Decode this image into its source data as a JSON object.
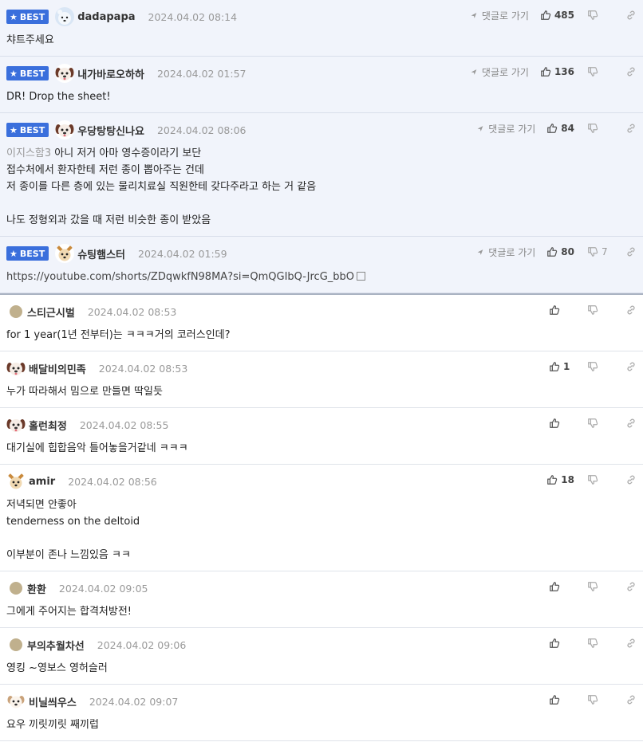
{
  "labels": {
    "best": "BEST",
    "reply": "댓글로 가기"
  },
  "colors": {
    "best_bg": "#f1f4fb",
    "badge": "#3a6fdc"
  },
  "comments": [
    {
      "best": true,
      "nick": "dadapapa",
      "date": "2024.04.02 08:14",
      "avatar": "bear-avatar",
      "up": "485",
      "down": "",
      "lines": [
        "챠트주세요"
      ]
    },
    {
      "best": true,
      "nick": "내가바로오하하",
      "date": "2024.04.02 01:57",
      "avatar": "dog-avatar",
      "up": "136",
      "down": "",
      "lines": [
        "DR! Drop the sheet!"
      ]
    },
    {
      "best": true,
      "nick": "우당탕탕신나요",
      "date": "2024.04.02 08:06",
      "avatar": "dog-avatar",
      "up": "84",
      "down": "",
      "mention": "이지스함3",
      "lines": [
        "아니 저거 아마 영수증이라기 보단",
        "접수처에서 환자한테 저런 종이 뽑아주는 건데",
        "저 종이를 다른 층에 있는 물리치료실 직원한테 갖다주라고 하는 거 같음",
        "",
        "나도 정형외과 갔을 때 저런 비슷한 종이 받았음"
      ]
    },
    {
      "best": true,
      "nick": "슈팅햄스터",
      "date": "2024.04.02 01:59",
      "avatar": "fox-avatar",
      "up": "80",
      "down": "7",
      "url": "https://youtube.com/shorts/ZDqwkfN98MA?si=QmQGIbQ-JrcG_bbO",
      "lines": []
    },
    {
      "best": false,
      "nick": "스티근시벌",
      "date": "2024.04.02 08:53",
      "avatar": "dot",
      "up": "",
      "down": "",
      "lines": [
        "for 1 year(1년 전부터)는 ㅋㅋㅋ거의 코러스인데?"
      ]
    },
    {
      "best": false,
      "nick": "배달비의민족",
      "date": "2024.04.02 08:53",
      "avatar": "dog-avatar",
      "up": "1",
      "down": "",
      "lines": [
        "누가 따라해서 밈으로 만들면 딱일듯"
      ]
    },
    {
      "best": false,
      "nick": "홀런최정",
      "date": "2024.04.02 08:55",
      "avatar": "dog-avatar",
      "up": "",
      "down": "",
      "lines": [
        "대기실에 힙합음악 틀어놓을거같네 ㅋㅋㅋ"
      ]
    },
    {
      "best": false,
      "nick": "amir",
      "date": "2024.04.02 08:56",
      "avatar": "fox-avatar",
      "up": "18",
      "down": "",
      "lines": [
        "저녁되면 안좋아",
        "tenderness on the deltoid",
        "",
        "이부분이 존나 느낌있음 ㅋㅋ"
      ]
    },
    {
      "best": false,
      "nick": "환환",
      "date": "2024.04.02 09:05",
      "avatar": "dot",
      "up": "",
      "down": "",
      "lines": [
        "그에게 주어지는 합격처방전!"
      ]
    },
    {
      "best": false,
      "nick": "부의추월차선",
      "date": "2024.04.02 09:06",
      "avatar": "dot",
      "up": "",
      "down": "",
      "lines": [
        "영킹 ~영보스 영허슬러"
      ]
    },
    {
      "best": false,
      "nick": "비닐씌우스",
      "date": "2024.04.02 09:07",
      "avatar": "puppy-avatar",
      "up": "",
      "down": "",
      "lines": [
        "요우 끼릿끼릿 째끼럽"
      ]
    }
  ]
}
